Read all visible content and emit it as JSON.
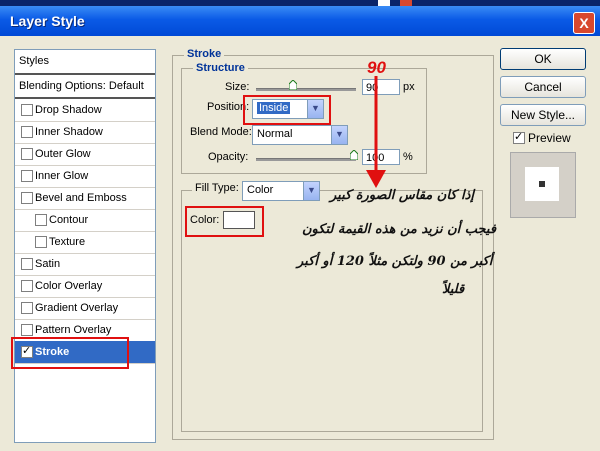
{
  "window": {
    "title": "Layer Style",
    "close": "X"
  },
  "styles_panel": {
    "header": "Styles",
    "blending": "Blending Options: Default",
    "items": [
      {
        "label": "Drop Shadow",
        "checked": false
      },
      {
        "label": "Inner Shadow",
        "checked": false
      },
      {
        "label": "Outer Glow",
        "checked": false
      },
      {
        "label": "Inner Glow",
        "checked": false
      },
      {
        "label": "Bevel and Emboss",
        "checked": false
      },
      {
        "label": "Contour",
        "checked": false
      },
      {
        "label": "Texture",
        "checked": false
      },
      {
        "label": "Satin",
        "checked": false
      },
      {
        "label": "Color Overlay",
        "checked": false
      },
      {
        "label": "Gradient Overlay",
        "checked": false
      },
      {
        "label": "Pattern Overlay",
        "checked": false
      },
      {
        "label": "Stroke",
        "checked": true
      }
    ]
  },
  "stroke": {
    "title": "Stroke",
    "structure_title": "Structure",
    "size_label": "Size:",
    "size_value": "90",
    "size_unit": "px",
    "position_label": "Position:",
    "position_value": "Inside",
    "blend_label": "Blend Mode:",
    "blend_value": "Normal",
    "opacity_label": "Opacity:",
    "opacity_value": "100",
    "opacity_unit": "%",
    "fill_type_label": "Fill Type:",
    "fill_type_value": "Color",
    "color_label": "Color:"
  },
  "buttons": {
    "ok": "OK",
    "cancel": "Cancel",
    "new_style": "New Style...",
    "preview": "Preview"
  },
  "annotation": {
    "number": "90",
    "line1": "إذا كان مقاس الصورة كبير",
    "line2": "فيجب أن نزيد من هذه القيمة لتكون",
    "line3": "أكبر من 90 ولتكن مثلاً 120 أو أكبر",
    "line4": "قليلاً"
  },
  "colors": {
    "annotation_red": "#e01010",
    "selection_blue": "#316ac5",
    "title_blue": "#0a5ae6"
  }
}
